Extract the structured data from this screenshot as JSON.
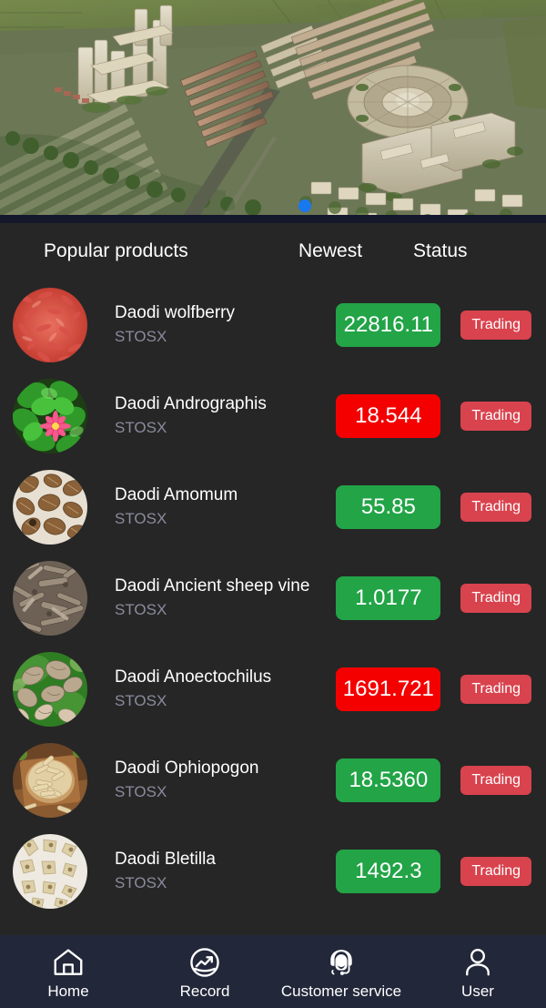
{
  "hero": {
    "name": "aerial-city-render-banner",
    "carousel_dot_color": "#1878f0",
    "dots": 1
  },
  "list_header": {
    "title": "Popular products",
    "newest": "Newest",
    "status": "Status"
  },
  "colors": {
    "background": "#262626",
    "nav_background": "#222739",
    "price_up": "#22a447",
    "price_down": "#f40000",
    "status_badge": "#d9434e",
    "subtitle": "#8b8b9e",
    "accent_dot": "#1878f0"
  },
  "products": [
    {
      "name": "Daodi wolfberry",
      "symbol": "STOSX",
      "price": "22816.11",
      "direction": "up",
      "status": "Trading",
      "thumb": "goji-berries-thumb"
    },
    {
      "name": "Daodi Andrographis",
      "symbol": "STOSX",
      "price": "18.544",
      "direction": "down",
      "status": "Trading",
      "thumb": "green-plant-flower-thumb"
    },
    {
      "name": "Daodi Amomum",
      "symbol": "STOSX",
      "price": "55.85",
      "direction": "up",
      "status": "Trading",
      "thumb": "brown-pods-thumb"
    },
    {
      "name": "Daodi Ancient sheep vine",
      "symbol": "STOSX",
      "price": "1.0177",
      "direction": "up",
      "status": "Trading",
      "thumb": "dried-roots-thumb"
    },
    {
      "name": "Daodi Anoectochilus",
      "symbol": "STOSX",
      "price": "1691.721",
      "direction": "down",
      "status": "Trading",
      "thumb": "jewel-orchid-thumb"
    },
    {
      "name": "Daodi Ophiopogon",
      "symbol": "STOSX",
      "price": "18.5360",
      "direction": "up",
      "status": "Trading",
      "thumb": "dried-tubers-bowl-thumb"
    },
    {
      "name": "Daodi Bletilla",
      "symbol": "STOSX",
      "price": "1492.3",
      "direction": "up",
      "status": "Trading",
      "thumb": "bletilla-slices-thumb"
    }
  ],
  "tabbar": {
    "items": [
      {
        "label": "Home",
        "icon": "home-icon",
        "active": true
      },
      {
        "label": "Record",
        "icon": "chart-circle-icon",
        "active": false
      },
      {
        "label": "Customer service",
        "icon": "headset-support-icon",
        "active": false
      },
      {
        "label": "User",
        "icon": "user-person-icon",
        "active": false
      }
    ]
  }
}
